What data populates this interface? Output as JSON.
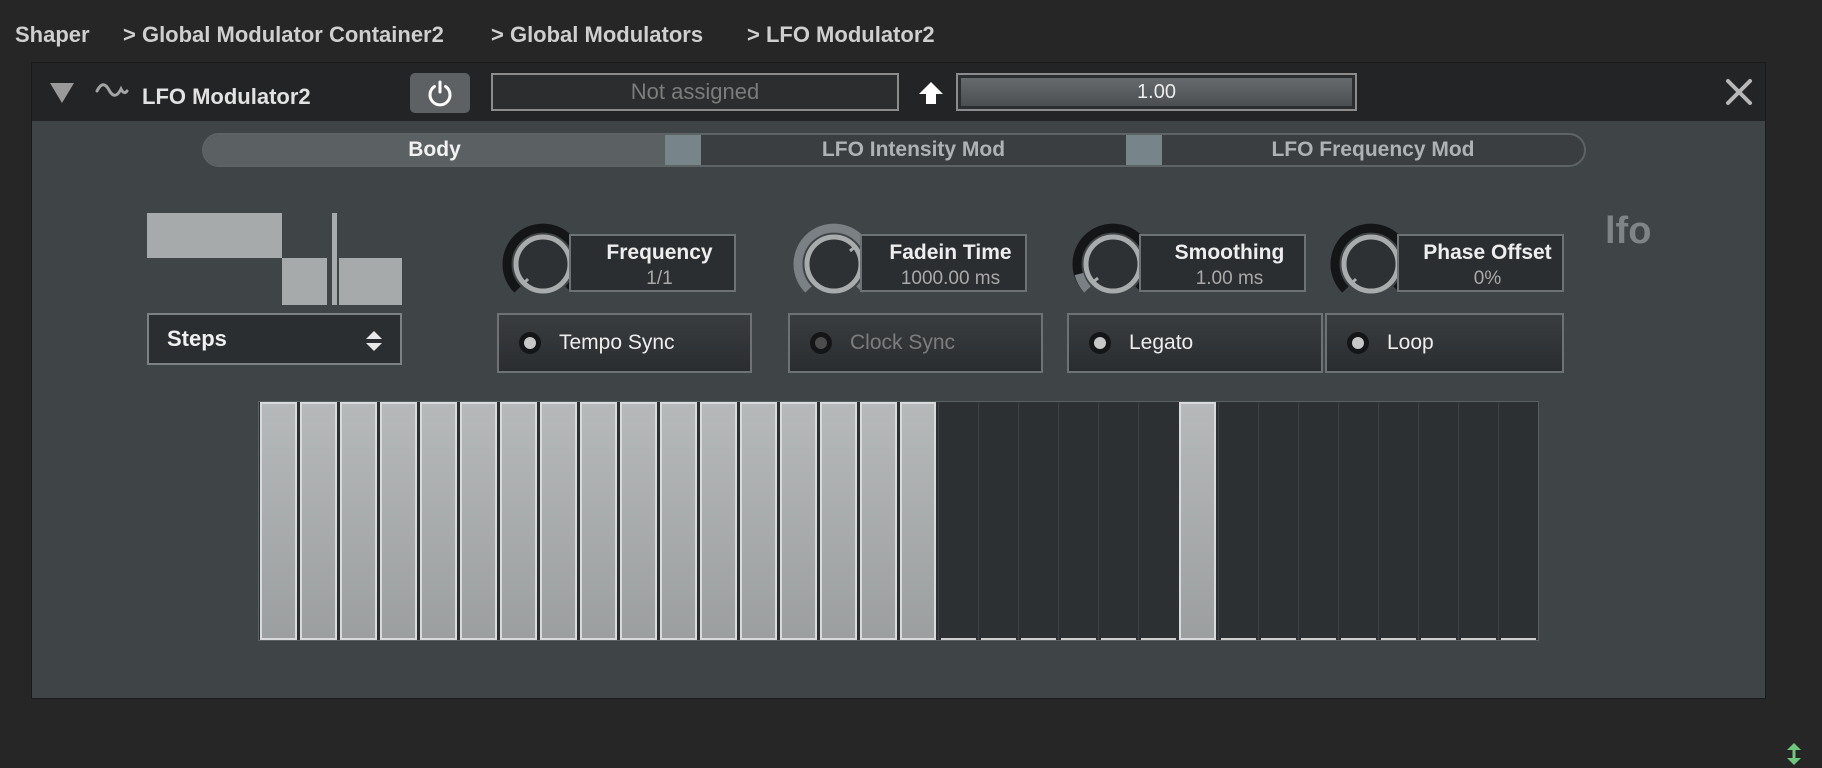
{
  "breadcrumb": {
    "items": [
      "Shaper",
      "> Global Modulator Container2",
      "> Global Modulators",
      "> LFO Modulator2"
    ]
  },
  "header": {
    "name": "LFO Modulator2",
    "assignment": "Not assigned",
    "value": "1.00",
    "icons": [
      "collapse-triangle-icon",
      "lfo-wave-icon",
      "power-icon",
      "arrow-up-icon",
      "close-icon"
    ]
  },
  "tabs": [
    {
      "label": "Body",
      "active": true
    },
    {
      "label": "LFO Intensity Mod",
      "active": false
    },
    {
      "label": "LFO Frequency Mod",
      "active": false
    }
  ],
  "waveform": {
    "mode": "Steps"
  },
  "knobs": [
    {
      "title": "Frequency",
      "value": "1/1"
    },
    {
      "title": "Fadein Time",
      "value": "1000.00 ms"
    },
    {
      "title": "Smoothing",
      "value": "1.00 ms"
    },
    {
      "title": "Phase Offset",
      "value": "0%"
    }
  ],
  "toggles": [
    {
      "label": "Tempo Sync",
      "enabled": true
    },
    {
      "label": "Clock Sync",
      "enabled": false
    },
    {
      "label": "Legato",
      "enabled": true
    },
    {
      "label": "Loop",
      "enabled": true
    }
  ],
  "tag": "lfo",
  "steps": {
    "values": [
      1,
      1,
      1,
      1,
      1,
      1,
      1,
      1,
      1,
      1,
      1,
      1,
      1,
      1,
      1,
      1,
      1,
      0,
      0,
      0,
      0,
      0,
      0,
      1,
      0,
      0,
      0,
      0,
      0,
      0,
      0,
      0
    ]
  },
  "colors": {
    "background": "#262626",
    "panel": "#3f4446",
    "step_on": "#a8abac",
    "accent_swatch": "#77858b"
  }
}
